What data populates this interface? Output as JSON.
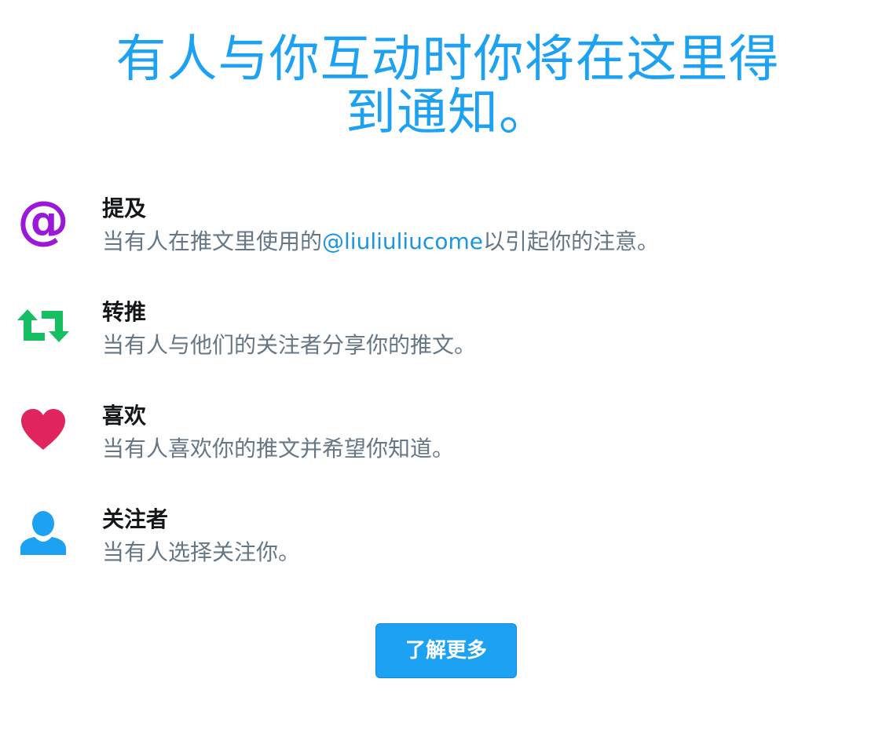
{
  "header": {
    "title_line1": "有人与你互动时你将在这里得",
    "title_line2": "到通知。"
  },
  "colors": {
    "accent": "#1da1f2",
    "mention_icon": "#9b17d9",
    "retweet_icon": "#17bf63",
    "like_icon": "#e0245e",
    "follower_icon": "#1da1f2"
  },
  "notifications": [
    {
      "icon": "at-sign-icon",
      "title": "提及",
      "desc_before": "当有人在推文里使用的",
      "mention": "@liuliuliucome",
      "desc_after": "以引起你的注意。"
    },
    {
      "icon": "retweet-icon",
      "title": "转推",
      "desc": "当有人与他们的关注者分享你的推文。"
    },
    {
      "icon": "heart-icon",
      "title": "喜欢",
      "desc": "当有人喜欢你的推文并希望你知道。"
    },
    {
      "icon": "person-icon",
      "title": "关注者",
      "desc": "当有人选择关注你。"
    }
  ],
  "learn_more": {
    "label": "了解更多"
  }
}
